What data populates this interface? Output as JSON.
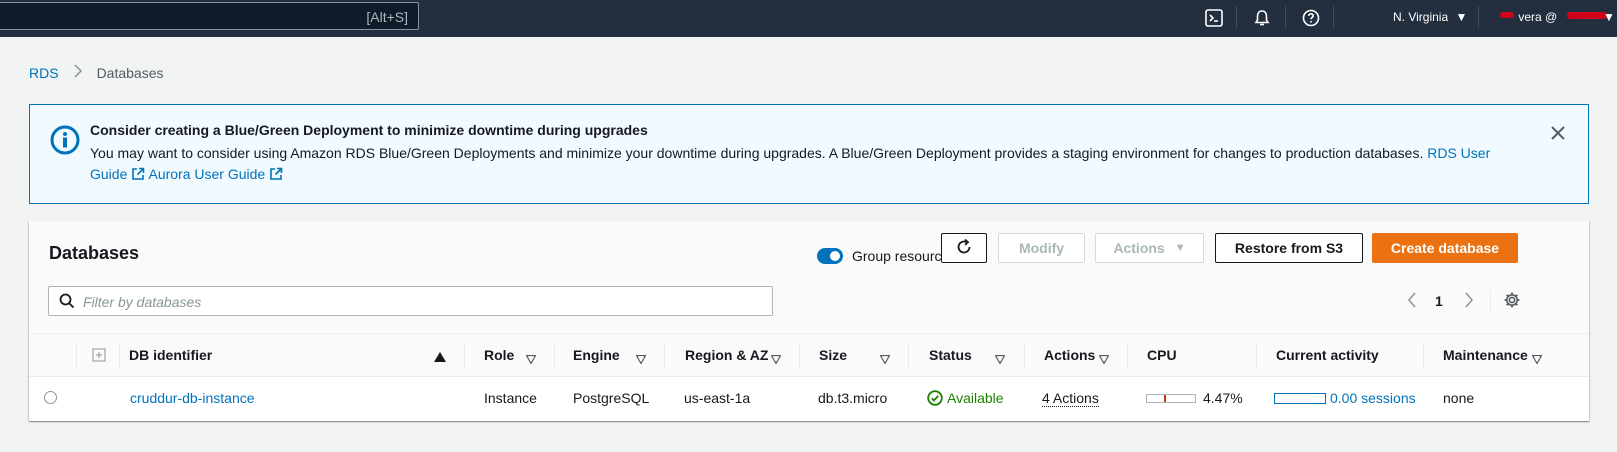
{
  "topnav": {
    "search_shortcut": "[Alt+S]",
    "region": "N. Virginia",
    "user": "vera @"
  },
  "breadcrumb": {
    "root": "RDS",
    "current": "Databases"
  },
  "banner": {
    "title": "Consider creating a Blue/Green Deployment to minimize downtime during upgrades",
    "text": "You may want to consider using Amazon RDS Blue/Green Deployments and minimize your downtime during upgrades. A Blue/Green Deployment provides a staging environment for changes to production databases.",
    "link1": "RDS User Guide",
    "link2": "Aurora User Guide"
  },
  "panel": {
    "title": "Databases",
    "group_label": "Group resources",
    "modify_label": "Modify",
    "actions_label": "Actions",
    "restore_label": "Restore from S3",
    "create_label": "Create database",
    "filter_placeholder": "Filter by databases",
    "page": "1"
  },
  "columns": {
    "id": "DB identifier",
    "role": "Role",
    "engine": "Engine",
    "region": "Region & AZ",
    "size": "Size",
    "status": "Status",
    "actions": "Actions",
    "cpu": "CPU",
    "activity": "Current activity",
    "maintenance": "Maintenance"
  },
  "rows": [
    {
      "id": "cruddur-db-instance",
      "role": "Instance",
      "engine": "PostgreSQL",
      "region": "us-east-1a",
      "size": "db.t3.micro",
      "status": "Available",
      "actions": "4 Actions",
      "cpu_fraction": 0.0447,
      "cpu": "4.47%",
      "activity": "0.00 sessions",
      "maintenance": "none"
    }
  ],
  "colors": {
    "accent": "#0073bb",
    "primary": "#ec7211",
    "success": "#1d8102",
    "nav": "#232f3e"
  }
}
